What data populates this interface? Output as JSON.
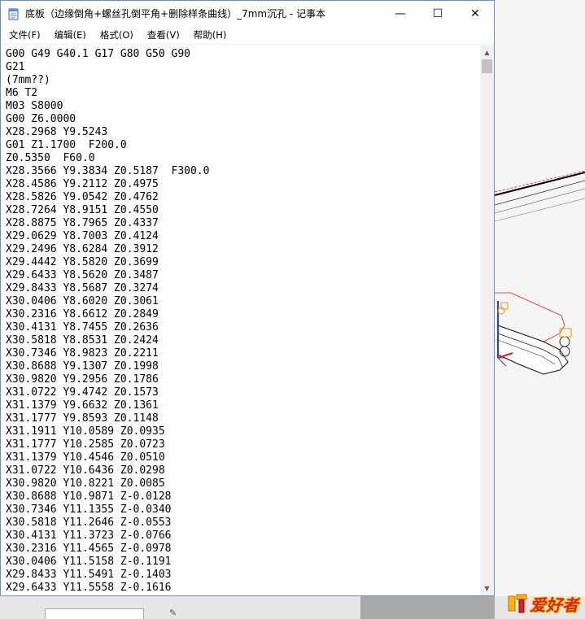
{
  "window": {
    "title": "底板（边缘倒角+螺丝孔倒平角+删除样条曲线）_7mm沉孔 - 记事本",
    "minimize": "—",
    "maximize": "☐",
    "close": "✕"
  },
  "menu": [
    {
      "label": "文件(F)"
    },
    {
      "label": "编辑(E)"
    },
    {
      "label": "格式(O)"
    },
    {
      "label": "查看(V)"
    },
    {
      "label": "帮助(H)"
    }
  ],
  "editor": {
    "lines": [
      "G00 G49 G40.1 G17 G80 G50 G90",
      "G21",
      "(7mm??)",
      "M6 T2",
      "M03 S8000",
      "G00 Z6.0000",
      "X28.2968 Y9.5243",
      "G01 Z1.1700  F200.0",
      "Z0.5350  F60.0",
      "X28.3566 Y9.3834 Z0.5187  F300.0",
      "X28.4586 Y9.2112 Z0.4975",
      "X28.5826 Y9.0542 Z0.4762",
      "X28.7264 Y8.9151 Z0.4550",
      "X28.8875 Y8.7965 Z0.4337",
      "X29.0629 Y8.7003 Z0.4124",
      "X29.2496 Y8.6284 Z0.3912",
      "X29.4442 Y8.5820 Z0.3699",
      "X29.6433 Y8.5620 Z0.3487",
      "X29.8433 Y8.5687 Z0.3274",
      "X30.0406 Y8.6020 Z0.3061",
      "X30.2316 Y8.6612 Z0.2849",
      "X30.4131 Y8.7455 Z0.2636",
      "X30.5818 Y8.8531 Z0.2424",
      "X30.7346 Y8.9823 Z0.2211",
      "X30.8688 Y9.1307 Z0.1998",
      "X30.9820 Y9.2956 Z0.1786",
      "X31.0722 Y9.4742 Z0.1573",
      "X31.1379 Y9.6632 Z0.1361",
      "X31.1777 Y9.8593 Z0.1148",
      "X31.1911 Y10.0589 Z0.0935",
      "X31.1777 Y10.2585 Z0.0723",
      "X31.1379 Y10.4546 Z0.0510",
      "X31.0722 Y10.6436 Z0.0298",
      "X30.9820 Y10.8221 Z0.0085",
      "X30.8688 Y10.9871 Z-0.0128",
      "X30.7346 Y11.1355 Z-0.0340",
      "X30.5818 Y11.2646 Z-0.0553",
      "X30.4131 Y11.3723 Z-0.0766",
      "X30.2316 Y11.4565 Z-0.0978",
      "X30.0406 Y11.5158 Z-0.1191",
      "X29.8433 Y11.5491 Z-0.1403",
      "X29.6433 Y11.5558 Z-0.1616"
    ]
  },
  "watermark": {
    "text": "爱好者"
  },
  "colors": {
    "titlebar": "#ffffff",
    "window_border": "#6d8fb8",
    "editor_bg": "#ffffff",
    "scroll_thumb": "#c2c2c2",
    "cad_red": "#e02020",
    "cad_blue": "#1a3cff"
  }
}
